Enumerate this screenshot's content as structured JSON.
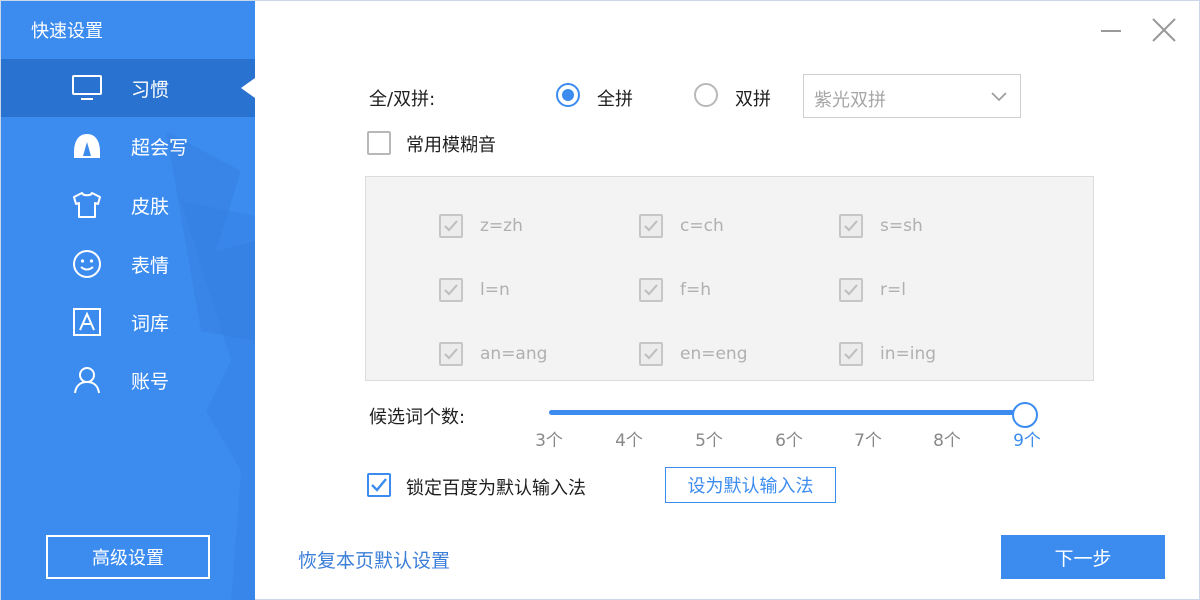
{
  "sidebar": {
    "title": "快速设置",
    "items": [
      {
        "label": "习惯",
        "icon": "monitor-icon",
        "active": true
      },
      {
        "label": "超会写",
        "icon": "pen-icon",
        "active": false
      },
      {
        "label": "皮肤",
        "icon": "shirt-icon",
        "active": false
      },
      {
        "label": "表情",
        "icon": "smiley-icon",
        "active": false
      },
      {
        "label": "词库",
        "icon": "dictionary-icon",
        "active": false
      },
      {
        "label": "账号",
        "icon": "user-icon",
        "active": false
      }
    ],
    "advanced_button": "高级设置"
  },
  "window": {
    "minimize_icon": "minimize-icon",
    "close_icon": "close-icon"
  },
  "pinyin": {
    "label": "全/双拼:",
    "options": [
      {
        "label": "全拼",
        "selected": true
      },
      {
        "label": "双拼",
        "selected": false
      }
    ],
    "scheme_select": {
      "value": "紫光双拼"
    }
  },
  "fuzzy": {
    "label": "常用模糊音",
    "checked": false,
    "pairs": [
      [
        "z=zh",
        "c=ch",
        "s=sh"
      ],
      [
        "l=n",
        "f=h",
        "r=l"
      ],
      [
        "an=ang",
        "en=eng",
        "in=ing"
      ]
    ]
  },
  "candidates": {
    "label": "候选词个数:",
    "ticks": [
      "3个",
      "4个",
      "5个",
      "6个",
      "7个",
      "8个",
      "9个"
    ],
    "selected": "9个"
  },
  "lock_default": {
    "label": "锁定百度为默认输入法",
    "checked": true
  },
  "set_default_button": "设为默认输入法",
  "footer": {
    "restore_link": "恢复本页默认设置",
    "next_button": "下一步"
  },
  "colors": {
    "accent": "#3c8cf0",
    "sidebar_bg": "#3c8cf0",
    "sidebar_active": "#2a72cf"
  }
}
